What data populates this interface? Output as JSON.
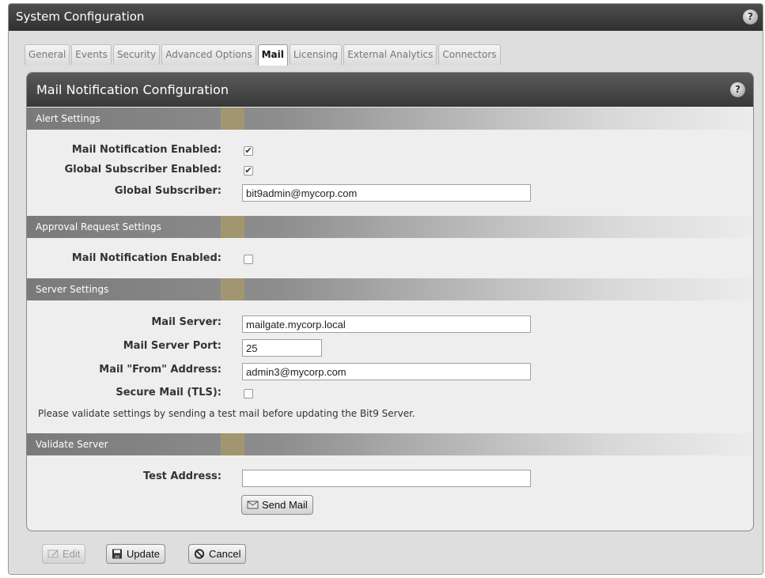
{
  "window": {
    "title": "System Configuration",
    "help_glyph": "?"
  },
  "tabs": [
    {
      "label": "General"
    },
    {
      "label": "Events"
    },
    {
      "label": "Security"
    },
    {
      "label": "Advanced Options"
    },
    {
      "label": "Mail",
      "active": true
    },
    {
      "label": "Licensing"
    },
    {
      "label": "External Analytics"
    },
    {
      "label": "Connectors"
    }
  ],
  "panel": {
    "title": "Mail Notification Configuration",
    "help_glyph": "?"
  },
  "alert_settings": {
    "header": "Alert Settings",
    "mail_notification_label": "Mail Notification Enabled:",
    "mail_notification_checked": true,
    "global_subscriber_enabled_label": "Global Subscriber Enabled:",
    "global_subscriber_enabled_checked": true,
    "global_subscriber_label": "Global Subscriber:",
    "global_subscriber_value": "bit9admin@mycorp.com"
  },
  "approval_settings": {
    "header": "Approval Request Settings",
    "mail_notification_label": "Mail Notification Enabled:",
    "mail_notification_checked": false
  },
  "server_settings": {
    "header": "Server Settings",
    "mail_server_label": "Mail Server:",
    "mail_server_value": "mailgate.mycorp.local",
    "port_label": "Mail Server Port:",
    "port_value": "25",
    "from_label": "Mail \"From\" Address:",
    "from_value": "admin3@mycorp.com",
    "tls_label": "Secure Mail (TLS):",
    "tls_checked": false,
    "note": "Please validate settings by sending a test mail before updating the Bit9 Server."
  },
  "validate_server": {
    "header": "Validate Server",
    "test_address_label": "Test Address:",
    "test_address_value": "",
    "send_button": "Send Mail"
  },
  "footer": {
    "edit_button": "Edit",
    "update_button": "Update",
    "cancel_button": "Cancel"
  },
  "check_glyph": "✔"
}
